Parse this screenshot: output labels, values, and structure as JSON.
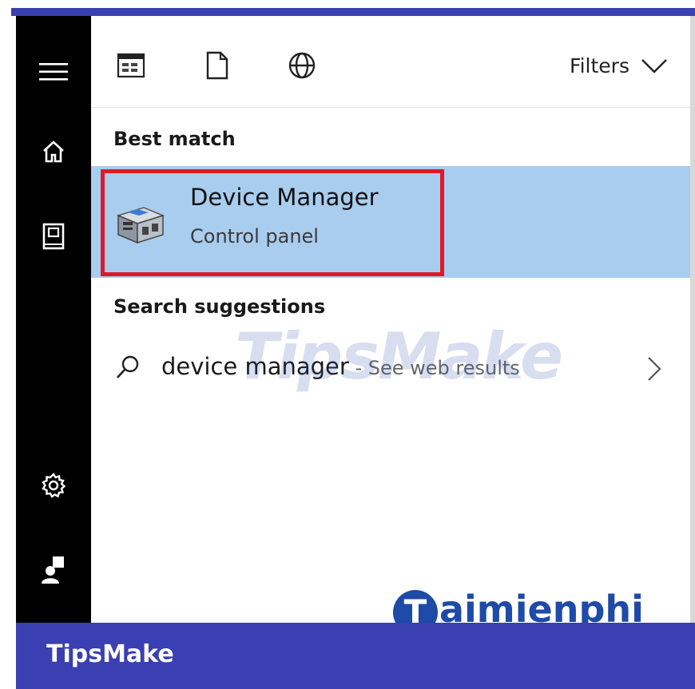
{
  "toolbar": {
    "filters_label": "Filters"
  },
  "best_match": {
    "section_title": "Best match",
    "app_name": "Device Manager",
    "app_type": "Control panel"
  },
  "suggestions": {
    "section_title": "Search suggestions",
    "query": "device manager",
    "web_hint": " - See web results"
  },
  "watermarks": {
    "center_text": "TipsMake",
    "taimienphi_text": "aimienphi",
    "taimienphi_initial": "T"
  },
  "footer": {
    "brand": "TipsMake"
  },
  "colors": {
    "sidebar": "#000000",
    "selected_row": "#a9cdef",
    "highlight_border": "#e01927",
    "band": "#3a3fb2"
  },
  "icons": {
    "sidebar": [
      "hamburger-menu-icon",
      "home-icon",
      "documents-icon",
      "settings-gear-icon",
      "user-account-icon"
    ],
    "toolbar": [
      "apps-icon",
      "document-icon",
      "globe-web-icon",
      "chevron-down-icon"
    ],
    "result": [
      "device-manager-icon",
      "search-icon",
      "chevron-right-icon"
    ]
  }
}
